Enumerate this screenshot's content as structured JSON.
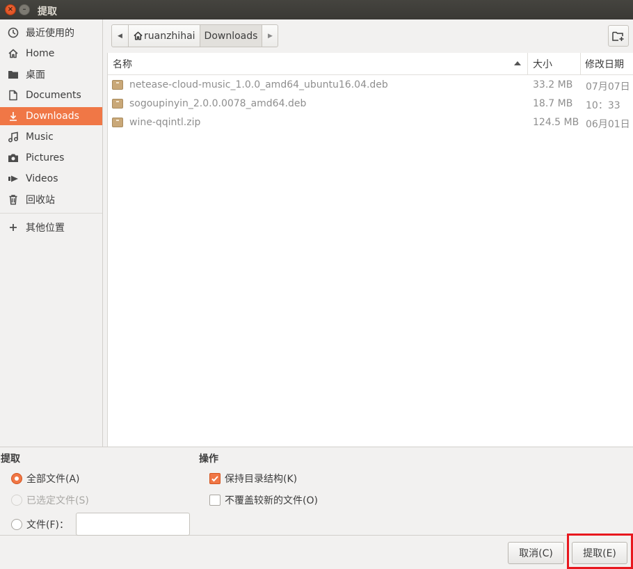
{
  "window": {
    "title": "提取"
  },
  "sidebar": {
    "items": [
      {
        "label": "最近使用的",
        "icon": "clock-icon"
      },
      {
        "label": "Home",
        "icon": "home-icon"
      },
      {
        "label": "桌面",
        "icon": "folder-icon"
      },
      {
        "label": "Documents",
        "icon": "document-icon"
      },
      {
        "label": "Downloads",
        "icon": "download-icon",
        "active": true
      },
      {
        "label": "Music",
        "icon": "music-icon"
      },
      {
        "label": "Pictures",
        "icon": "camera-icon"
      },
      {
        "label": "Videos",
        "icon": "video-icon"
      },
      {
        "label": "回收站",
        "icon": "trash-icon"
      },
      {
        "label": "其他位置",
        "icon": "plus-icon"
      }
    ]
  },
  "pathbar": {
    "segments": [
      "ruanzhihai",
      "Downloads"
    ]
  },
  "filelist": {
    "columns": {
      "name": "名称",
      "size": "大小",
      "date": "修改日期"
    },
    "files": [
      {
        "name": "netease-cloud-music_1.0.0_amd64_ubuntu16.04.deb",
        "size": "33.2 MB",
        "date": "07月07日"
      },
      {
        "name": "sogoupinyin_2.0.0.0078_amd64.deb",
        "size": "18.7 MB",
        "date": "10：33"
      },
      {
        "name": "wine-qqintl.zip",
        "size": "124.5 MB",
        "date": "06月01日"
      }
    ]
  },
  "extract": {
    "title": "提取",
    "all_files": "全部文件(A)",
    "selected_files": "已选定文件(S)",
    "files_label": "文件(F)：",
    "files_value": ""
  },
  "actions": {
    "title": "操作",
    "keep_structure": "保持目录结构(K)",
    "no_overwrite": "不覆盖较新的文件(O)"
  },
  "buttons": {
    "cancel": "取消(C)",
    "extract": "提取(E)"
  },
  "colors": {
    "accent": "#f07746",
    "highlight": "#e8171e"
  }
}
